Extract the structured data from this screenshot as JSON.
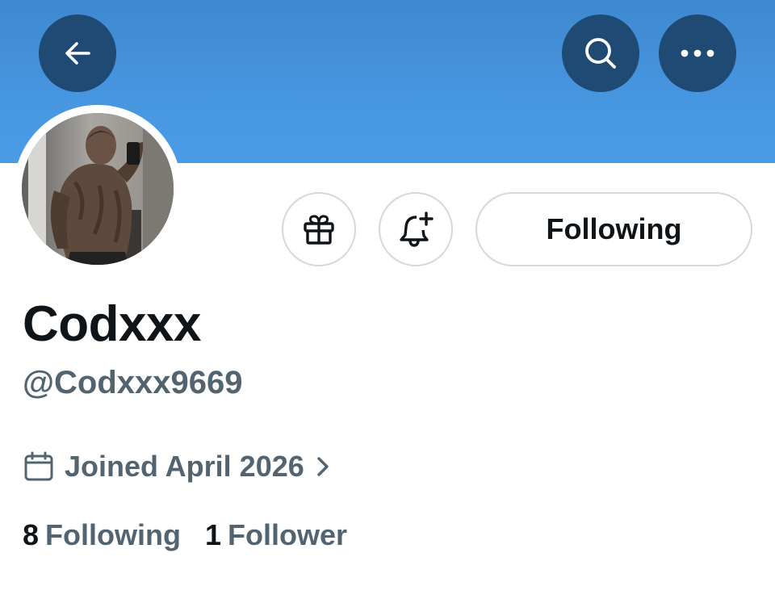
{
  "header": {
    "back_icon": "arrow-left-icon",
    "search_icon": "search-icon",
    "more_icon": "more-horizontal-icon",
    "banner_color": "#4796e0",
    "button_color": "#1f4a74"
  },
  "profile": {
    "avatar_icon": "profile-photo",
    "display_name": "Codxxx",
    "handle": "@Codxxx9669",
    "joined": "Joined April 2026"
  },
  "actions": {
    "gift_icon": "gift-icon",
    "notify_icon": "bell-plus-icon",
    "following_label": "Following"
  },
  "stats": {
    "following_count": "8",
    "following_label": "Following",
    "followers_count": "1",
    "followers_label": "Follower"
  },
  "colors": {
    "text_primary": "#0f1419",
    "text_secondary": "#536471",
    "border": "#cfd9de"
  }
}
